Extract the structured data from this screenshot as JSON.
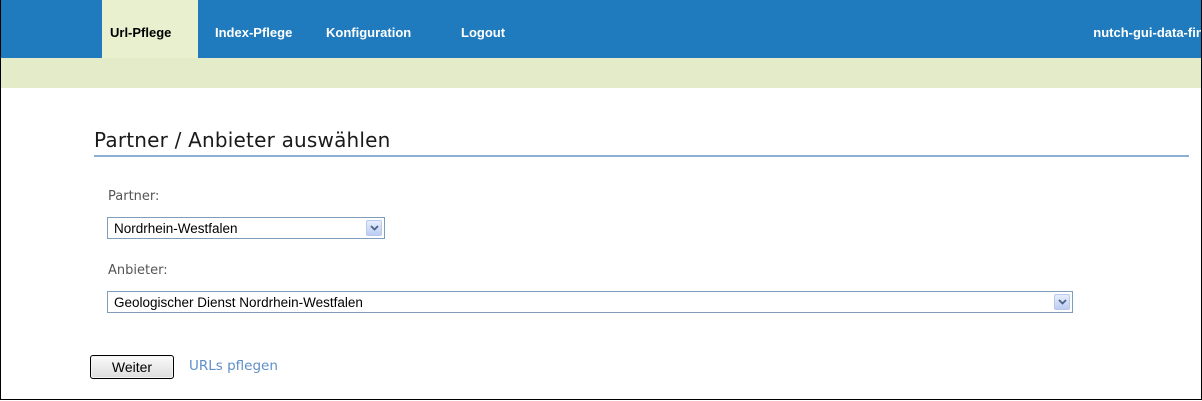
{
  "nav": {
    "tabs": [
      {
        "label": "Url-Pflege",
        "active": true
      },
      {
        "label": "Index-Pflege",
        "active": false
      },
      {
        "label": "Konfiguration",
        "active": false
      },
      {
        "label": "Logout",
        "active": false
      }
    ],
    "app_name": "nutch-gui-data-fina"
  },
  "main": {
    "title": "Partner / Anbieter auswählen",
    "partner": {
      "label": "Partner:",
      "selected": "Nordrhein-Westfalen"
    },
    "anbieter": {
      "label": "Anbieter:",
      "selected": "Geologischer Dienst Nordrhein-Westfalen"
    },
    "submit_label": "Weiter",
    "link_label": "URLs pflegen"
  },
  "icons": {
    "dropdown": "chevron-down-icon"
  },
  "colors": {
    "nav_background": "#1f7bbd",
    "subbar_background": "#e3ebc9",
    "active_tab": "#e9f0cf",
    "link": "#5f8fc7",
    "title_rule": "#8ab0d3"
  }
}
